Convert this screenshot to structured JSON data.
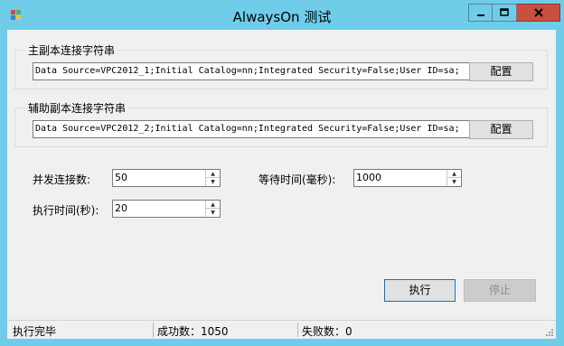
{
  "window": {
    "title": "AlwaysOn 测试"
  },
  "primary": {
    "group_title": "主副本连接字符串",
    "conn_value": "Data Source=VPC2012_1;Initial Catalog=nn;Integrated Security=False;User ID=sa;",
    "config_label": "配置"
  },
  "secondary": {
    "group_title": "辅助副本连接字符串",
    "conn_value": "Data Source=VPC2012_2;Initial Catalog=nn;Integrated Security=False;User ID=sa;",
    "config_label": "配置"
  },
  "params": {
    "concurrency_label": "并发连接数:",
    "concurrency_value": "50",
    "wait_label": "等待时间(毫秒):",
    "wait_value": "1000",
    "exec_label": "执行时间(秒):",
    "exec_value": "20"
  },
  "actions": {
    "run_label": "执行",
    "stop_label": "停止"
  },
  "status": {
    "message": "执行完毕",
    "success": "成功数：1050",
    "failure": "失败数：0"
  },
  "colors": {
    "titlebar": "#6fcdea",
    "close_button": "#c7503f",
    "client_bg": "#f0f0f0"
  }
}
